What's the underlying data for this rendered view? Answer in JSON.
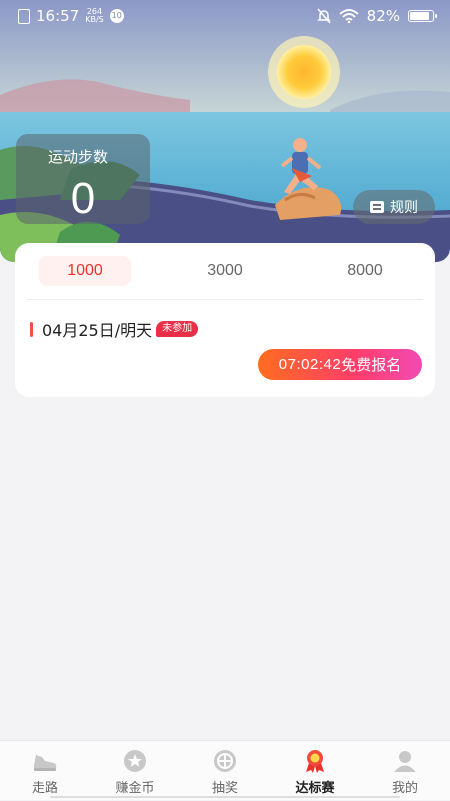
{
  "status_bar": {
    "time": "16:57",
    "net_speed_top": "264",
    "net_speed_bottom": "KB/S",
    "notification_count": "10",
    "battery": "82%"
  },
  "hero": {
    "steps_label": "运动步数",
    "steps_value": "0",
    "rules_label": "规则"
  },
  "tabs": [
    {
      "label": "1000",
      "active": true
    },
    {
      "label": "3000",
      "active": false
    },
    {
      "label": "8000",
      "active": false
    }
  ],
  "event": {
    "date": "04月25日/明天",
    "status": "未参加",
    "countdown": "07:02:42",
    "signup_label": "免费报名"
  },
  "bottom_nav": [
    {
      "label": "走路",
      "icon": "shoe-icon"
    },
    {
      "label": "赚金币",
      "icon": "coin-icon"
    },
    {
      "label": "抽奖",
      "icon": "lottery-wheel-icon"
    },
    {
      "label": "达标赛",
      "icon": "medal-icon",
      "active": true
    },
    {
      "label": "我的",
      "icon": "user-icon"
    }
  ],
  "colors": {
    "accent": "#e8322c",
    "badge": "#ea2f49",
    "gradient_start": "#ff6d1f",
    "gradient_end": "#f24bb4"
  }
}
